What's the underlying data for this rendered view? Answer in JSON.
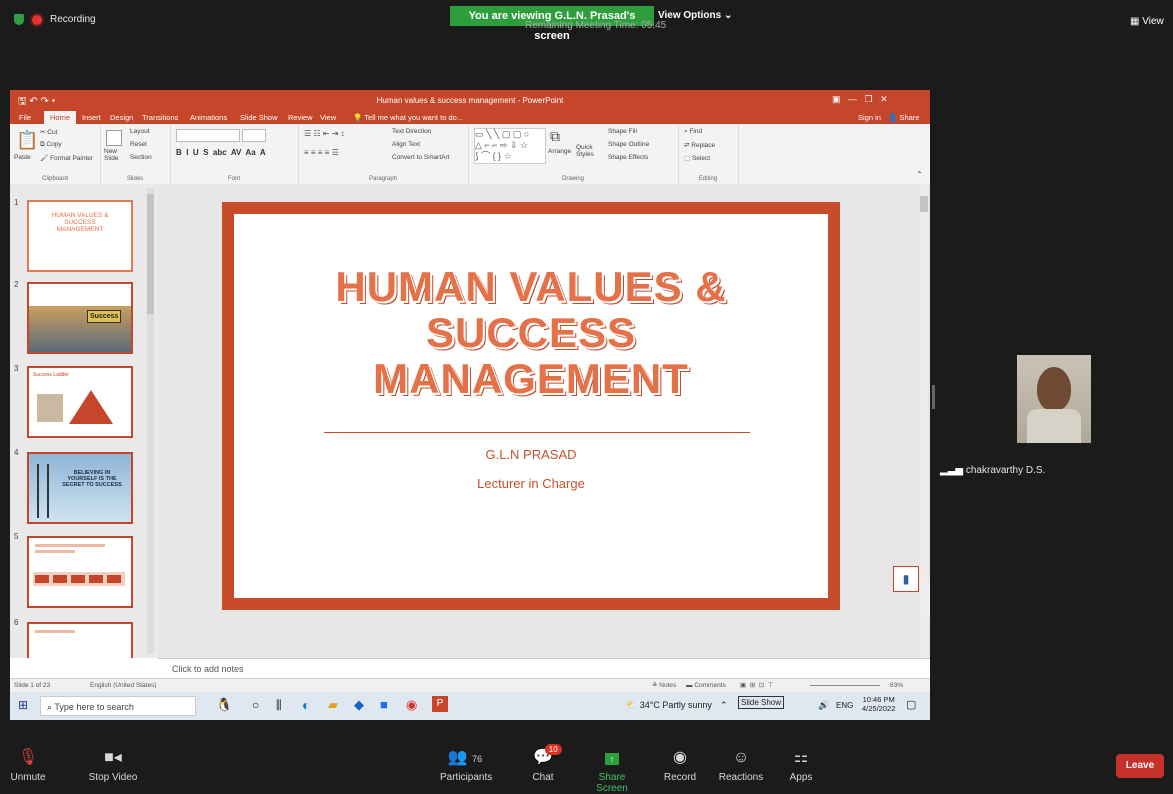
{
  "zoom": {
    "recording_label": "Recording",
    "viewing_banner": "You are viewing G.L.N. Prasad's screen",
    "remaining_time": "Remaining Meeting Time: 05:45",
    "view_options": "View Options ⌄",
    "view_label": "View"
  },
  "powerpoint": {
    "window_title": "Human values & success management - PowerPoint",
    "sign_in": "Sign in",
    "share": "Share",
    "tabs": [
      "File",
      "Home",
      "Insert",
      "Design",
      "Transitions",
      "Animations",
      "Slide Show",
      "Review",
      "View"
    ],
    "tell_me": "Tell me what you want to do...",
    "ribbon": {
      "clipboard": {
        "paste": "Paste",
        "cut": "Cut",
        "copy": "Copy",
        "format_painter": "Format Painter",
        "label": "Clipboard"
      },
      "slides": {
        "new_slide": "New Slide",
        "layout": "Layout",
        "reset": "Reset",
        "section": "Section",
        "label": "Slides"
      },
      "font": {
        "label": "Font"
      },
      "paragraph": {
        "text_direction": "Text Direction",
        "align_text": "Align Text",
        "convert_smartart": "Convert to SmartArt",
        "label": "Paragraph"
      },
      "drawing": {
        "arrange": "Arrange",
        "quick_styles": "Quick Styles",
        "shape_fill": "Shape Fill",
        "shape_outline": "Shape Outline",
        "shape_effects": "Shape Effects",
        "label": "Drawing"
      },
      "editing": {
        "find": "Find",
        "replace": "Replace",
        "select": "Select",
        "label": "Editing"
      }
    },
    "thumbnails": [
      {
        "num": "1",
        "text": "HUMAN VALUES & SUCCESS MANAGEMENT"
      },
      {
        "num": "2",
        "text": "Success"
      },
      {
        "num": "3",
        "text": "Success Ladder"
      },
      {
        "num": "4",
        "text": "BELIEVING IN YOURSELF IS THE SECRET TO SUCCESS"
      },
      {
        "num": "5",
        "text": ""
      },
      {
        "num": "6",
        "text": ""
      }
    ],
    "slide": {
      "title_line1": "HUMAN VALUES &",
      "title_line2": "SUCCESS",
      "title_line3": "MANAGEMENT",
      "author": "G.L.N PRASAD",
      "role": "Lecturer in Charge"
    },
    "notes_placeholder": "Click to add notes",
    "status": {
      "slide_count": "Slide 1 of 23",
      "language": "English (United States)",
      "notes": "Notes",
      "comments": "Comments",
      "zoom": "83%"
    }
  },
  "windows_taskbar": {
    "search_placeholder": "Type here to search",
    "weather": "34°C Partly sunny",
    "slide_show_label": "Slide Show",
    "lang": "ENG",
    "time": "10:46 PM",
    "date": "4/25/2022"
  },
  "participant": {
    "name": "chakravarthy D.S."
  },
  "toolbar": {
    "unmute": "Unmute",
    "stop_video": "Stop Video",
    "participants": "Participants",
    "participant_count": "76",
    "chat": "Chat",
    "chat_badge": "10",
    "share_screen": "Share Screen",
    "record": "Record",
    "reactions": "Reactions",
    "apps": "Apps",
    "leave": "Leave"
  },
  "colors": {
    "ppt_accent": "#c5462a",
    "zoom_green": "#2e9e3d",
    "leave_red": "#c7312b"
  }
}
